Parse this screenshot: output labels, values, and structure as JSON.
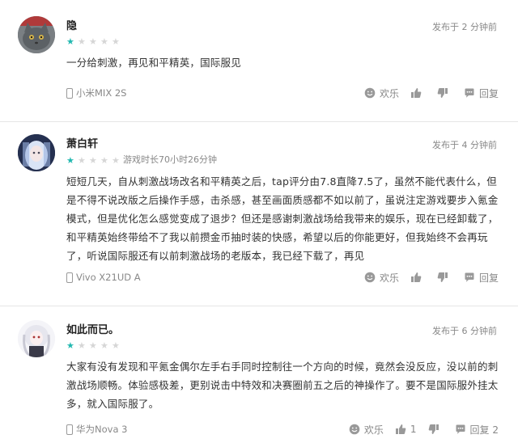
{
  "reviews": [
    {
      "user": "隐",
      "time": "发布于 2 分钟前",
      "rating": 1,
      "playtime": "",
      "text": "一分给刺激，再见和平精英，国际服见",
      "device": "小米MIX 2S",
      "fun_label": "欢乐",
      "like_count": "",
      "dislike_count": "",
      "reply_label": "回复"
    },
    {
      "user": "萧白轩",
      "time": "发布于 4 分钟前",
      "rating": 1,
      "playtime": "游戏时长70小时26分钟",
      "text": "短短几天，自从刺激战场改名和平精英之后，tap评分由7.8直降7.5了，虽然不能代表什么，但是不得不说改版之后操作手感，击杀感，甚至画面质感都不如以前了，虽说注定游戏要步入氪金模式，但是优化怎么感觉变成了退步？但还是感谢刺激战场给我带来的娱乐，现在已经卸载了，和平精英始终带给不了我以前攒金币抽时装的快感，希望以后的你能更好，但我始终不会再玩了，听说国际服还有以前刺激战场的老版本，我已经下载了，再见",
      "device": "Vivo X21UD A",
      "fun_label": "欢乐",
      "like_count": "",
      "dislike_count": "",
      "reply_label": "回复"
    },
    {
      "user": "如此而已。",
      "time": "发布于 6 分钟前",
      "rating": 1,
      "playtime": "",
      "text": "大家有没有发现和平氪金偶尔左手右手同时控制往一个方向的时候，竟然会没反应，没以前的刺激战场顺畅。体验感极差，更别说击中特效和决赛圈前五之后的神操作了。要不是国际服外挂太多，就入国际服了。",
      "device": "华为Nova 3",
      "fun_label": "欢乐",
      "like_count": "1",
      "dislike_count": "",
      "reply_label": "回复 2"
    }
  ],
  "colors": {
    "accent_star": "#22b8b0",
    "muted": "#888888",
    "divider": "#e6e6e6"
  },
  "icons": [
    "smile-icon",
    "thumb-up-icon",
    "thumb-down-icon",
    "comment-icon",
    "phone-icon"
  ]
}
